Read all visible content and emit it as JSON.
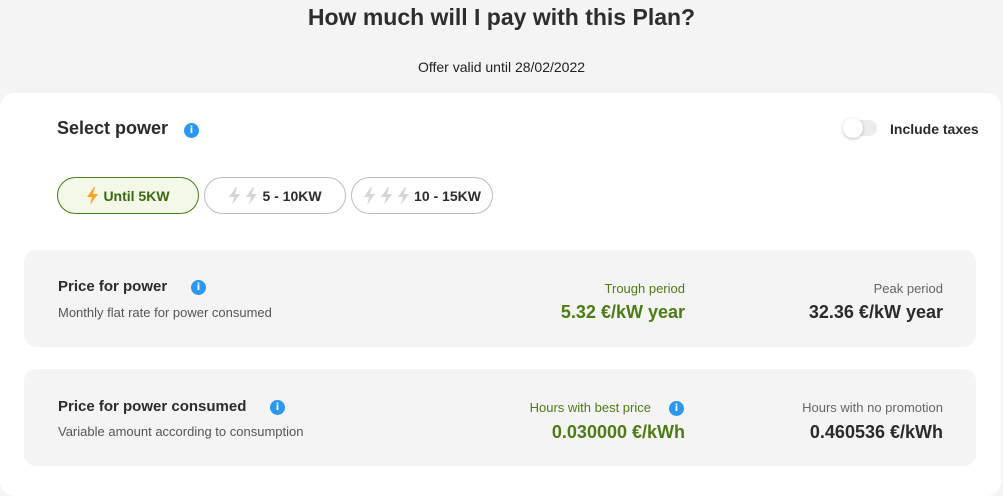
{
  "header": {
    "title": "How much will I pay with this Plan?",
    "offer_valid": "Offer valid until 28/02/2022"
  },
  "select_power": {
    "title": "Select power",
    "include_taxes_label": "Include taxes",
    "include_taxes_on": false,
    "options": [
      {
        "label": "Until 5KW",
        "bolts": 1,
        "selected": true
      },
      {
        "label": "5 - 10KW",
        "bolts": 2,
        "selected": false
      },
      {
        "label": "10 - 15KW",
        "bolts": 3,
        "selected": false
      }
    ]
  },
  "power_price": {
    "title": "Price for power",
    "description": "Monthly flat rate for power consumed",
    "trough_label": "Trough period",
    "trough_value": "5.32 €/kW year",
    "peak_label": "Peak period",
    "peak_value": "32.36 €/kW year"
  },
  "consumed_price": {
    "title": "Price for power consumed",
    "description": "Variable amount according to consumption",
    "best_label": "Hours with best price",
    "best_value": "0.030000 €/kWh",
    "nopromo_label": "Hours with no promotion",
    "nopromo_value": "0.460536 €/kWh"
  },
  "colors": {
    "accent_green": "#4d7b15",
    "info_blue": "#2a97f0",
    "bolt_orange": "#f5a623",
    "bolt_gray": "#d6d6d6"
  },
  "icons": {
    "info": "info-icon",
    "bolt": "lightning-bolt-icon"
  }
}
